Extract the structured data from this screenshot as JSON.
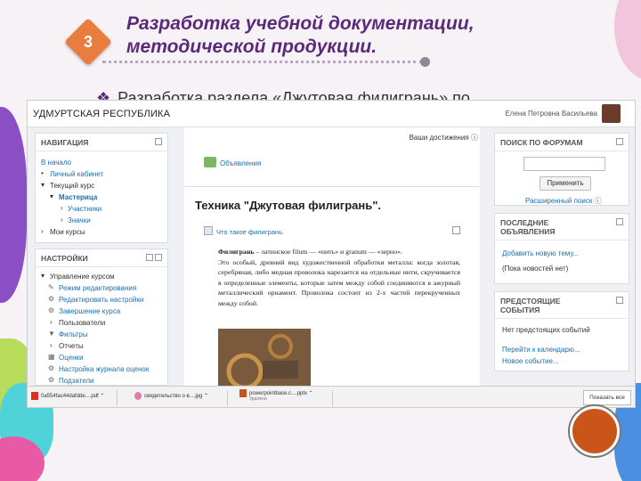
{
  "slide": {
    "badge_number": "3",
    "title": "Разработка учебной документации, методической продукции.",
    "bullet_text": "Разработка раздела «Джутовая филигрань» по"
  },
  "browser": {
    "site_name": "УДМУРТСКАЯ РЕСПУБЛИКА",
    "user_name": "Елена Петровна Васильева"
  },
  "nav_block": {
    "title": "НАВИГАЦИЯ",
    "items": [
      "В начало",
      "Личный кабинет",
      "Текущий курс",
      "Мастерица",
      "Участники",
      "Значки",
      "Мои курсы"
    ]
  },
  "settings_block": {
    "title": "НАСТРОЙКИ",
    "items": [
      "Управление курсом",
      "Режим редактирования",
      "Редактировать настройки",
      "Завершение курса",
      "Пользователи",
      "Фильтры",
      "Отчеты",
      "Оценки",
      "Настройка журнала оценок",
      "Подзатели"
    ]
  },
  "center": {
    "achievements": "Ваши достижения",
    "announcements": "Объявления",
    "section_title": "Техника \"Джутовая филигрань\".",
    "what_link": "Что такое филигрань.",
    "paragraph1_bold": "Филигрань",
    "paragraph1": " – латинское filum — «нить» и granum — «зерно».",
    "paragraph2": "Это особый, древний вид художественной обработки металла: когда золотая, серебряная, либо медная проволока нарезается на отдельные нити, скручивается в определенные элементы, которые затем между собой соединяются в ажурный металлический орнамент. Проволока состоит из 2-х частей перекрученных между собой."
  },
  "search_block": {
    "title": "ПОИСК ПО ФОРУМАМ",
    "button": "Применить",
    "advanced": "Расширенный поиск"
  },
  "news_block": {
    "title": "ПОСЛЕДНИЕ ОБЪЯВЛЕНИЯ",
    "add": "Добавить новую тему...",
    "empty": "(Пока новостей нет)"
  },
  "events_block": {
    "title": "ПРЕДСТОЯЩИЕ СОБЫТИЯ",
    "empty": "Нет предстоящих событий",
    "calendar": "Перейти к календарю...",
    "new_event": "Новое событие..."
  },
  "downloads": {
    "items": [
      {
        "name": "0a554fac44dafdde....pdf",
        "sub": ""
      },
      {
        "name": "свидетельство о в....jpg",
        "sub": ""
      },
      {
        "name": "powerpointbase.c....pptx",
        "sub": "Удалено"
      }
    ],
    "show_all": "Показать все"
  },
  "colors": {
    "title": "#5a2a7a",
    "badge": "#e87d3e",
    "link": "#1a6fb0",
    "circle": "#c9551a"
  }
}
